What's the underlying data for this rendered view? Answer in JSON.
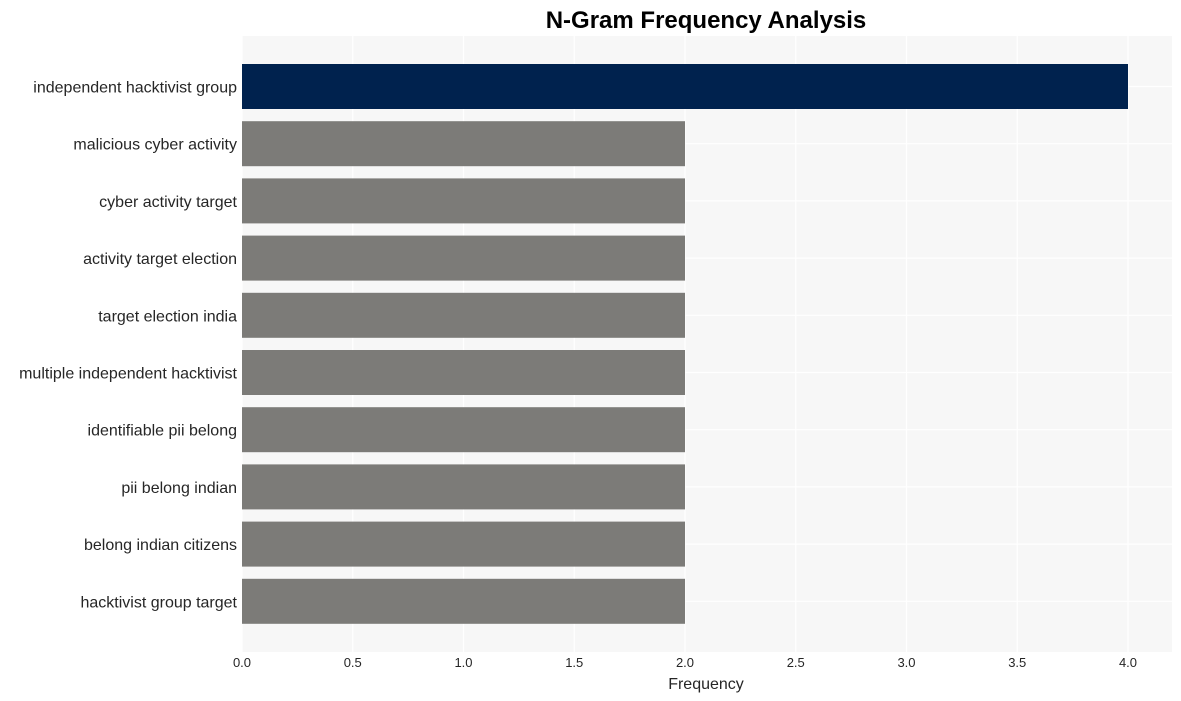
{
  "chart_data": {
    "type": "bar",
    "orientation": "horizontal",
    "title": "N-Gram Frequency Analysis",
    "xlabel": "Frequency",
    "ylabel": "",
    "xlim": [
      0,
      4.2
    ],
    "xticks": [
      "0.0",
      "0.5",
      "1.0",
      "1.5",
      "2.0",
      "2.5",
      "3.0",
      "3.5",
      "4.0"
    ],
    "xtick_values": [
      0,
      0.5,
      1.0,
      1.5,
      2.0,
      2.5,
      3.0,
      3.5,
      4.0
    ],
    "grid": true,
    "categories": [
      "independent hacktivist group",
      "malicious cyber activity",
      "cyber activity target",
      "activity target election",
      "target election india",
      "multiple independent hacktivist",
      "identifiable pii belong",
      "pii belong indian",
      "belong indian citizens",
      "hacktivist group target"
    ],
    "values": [
      4,
      2,
      2,
      2,
      2,
      2,
      2,
      2,
      2,
      2
    ],
    "colors": {
      "highlight": "#00224e",
      "default": "#7c7b78",
      "plot_background": "#f7f7f7",
      "grid": "#ffffff"
    }
  }
}
